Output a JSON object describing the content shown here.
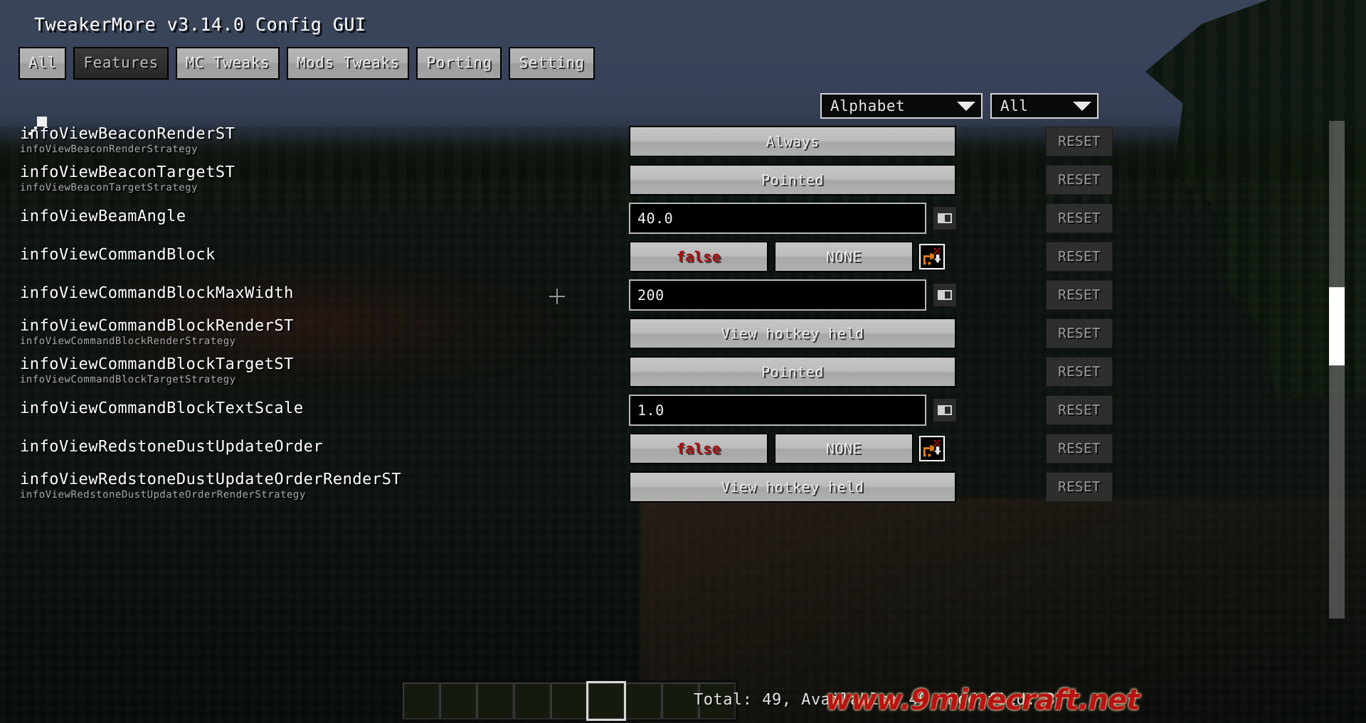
{
  "window": {
    "title": "TweakerMore v3.14.0 Config GUI"
  },
  "tabs": [
    {
      "label": "All",
      "selected": false
    },
    {
      "label": "Features",
      "selected": true
    },
    {
      "label": "MC Tweaks",
      "selected": false
    },
    {
      "label": "Mods Tweaks",
      "selected": false
    },
    {
      "label": "Porting",
      "selected": false
    },
    {
      "label": "Setting",
      "selected": false
    }
  ],
  "search": {
    "icon": "search-icon"
  },
  "dropdowns": {
    "sort": {
      "value": "Alphabet",
      "caret_icon": "chevron-down-icon"
    },
    "filter": {
      "value": "All",
      "caret_icon": "chevron-down-icon"
    }
  },
  "reset_label": "RESET",
  "icons": {
    "slider_toggle": "slider-toggle-icon",
    "keybind_settings": "keybind-settings-icon"
  },
  "entries": [
    {
      "name": "infoViewBeaconRenderST",
      "subtitle": "infoViewBeaconRenderStrategy",
      "widget": "button",
      "value": "Always"
    },
    {
      "name": "infoViewBeaconTargetST",
      "subtitle": "infoViewBeaconTargetStrategy",
      "widget": "button",
      "value": "Pointed"
    },
    {
      "name": "infoViewBeamAngle",
      "subtitle": "",
      "widget": "numeric",
      "value": "40.0"
    },
    {
      "name": "infoViewCommandBlock",
      "subtitle": "",
      "widget": "boolean",
      "value": "false",
      "keybind": "NONE"
    },
    {
      "name": "infoViewCommandBlockMaxWidth",
      "subtitle": "",
      "widget": "numeric",
      "value": "200"
    },
    {
      "name": "infoViewCommandBlockRenderST",
      "subtitle": "infoViewCommandBlockRenderStrategy",
      "widget": "button",
      "value": "View hotkey held"
    },
    {
      "name": "infoViewCommandBlockTargetST",
      "subtitle": "infoViewCommandBlockTargetStrategy",
      "widget": "button",
      "value": "Pointed"
    },
    {
      "name": "infoViewCommandBlockTextScale",
      "subtitle": "",
      "widget": "numeric",
      "value": "1.0"
    },
    {
      "name": "infoViewRedstoneDustUpdateOrder",
      "subtitle": "",
      "widget": "boolean",
      "value": "false",
      "keybind": "NONE"
    },
    {
      "name": "infoViewRedstoneDustUpdateOrderRenderST",
      "subtitle": "infoViewRedstoneDustUpdateOrderRenderStrategy",
      "widget": "button",
      "value": "View hotkey held"
    }
  ],
  "status": {
    "text": "Total: 49, Available: 49, Modified: 3"
  },
  "watermark": {
    "text": "www.9minecraft.net"
  },
  "hotbar": {
    "slot_count": 9,
    "selected_index": 5
  },
  "colors": {
    "button_face": "#bcbcbc",
    "false_red": "#a80f0f",
    "reset_bg": "#2e2e2e",
    "field_bg": "#000000",
    "accent_orange": "#e08010",
    "watermark_red": "#b81414"
  }
}
